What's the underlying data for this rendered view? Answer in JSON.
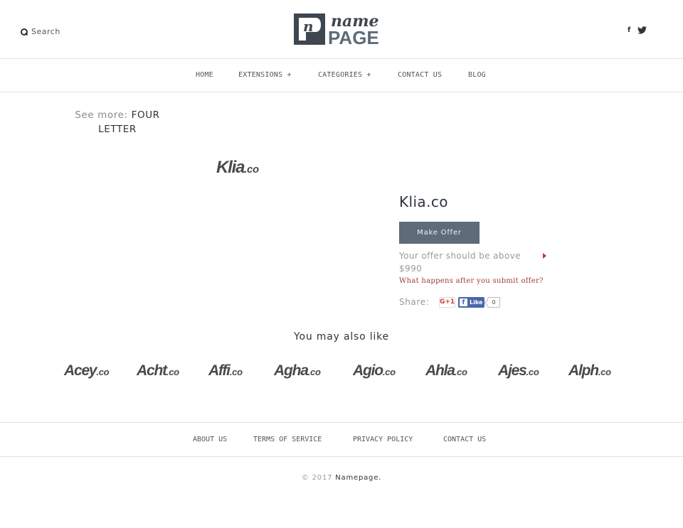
{
  "header": {
    "search_label": "Search",
    "logo": {
      "line1": "name",
      "line2": "PAGE",
      "mark": "n"
    },
    "social": {
      "facebook": "f"
    }
  },
  "nav": {
    "items": [
      {
        "label": "HOME"
      },
      {
        "label": "EXTENSIONS +"
      },
      {
        "label": "CATEGORIES +"
      },
      {
        "label": "CONTACT US"
      },
      {
        "label": "BLOG"
      }
    ]
  },
  "see_more": {
    "prefix": "See more:",
    "link": "FOUR LETTER"
  },
  "product": {
    "logo_name": "Klia",
    "logo_tld": ".co",
    "title": "Klia.co",
    "offer_button": "Make Offer",
    "offer_note": "Your offer should be above $990",
    "offer_help": "What happens after you submit offer?",
    "share_label": "Share:",
    "gplus_label": "G+1",
    "fb_like_label": "Like",
    "fb_like_count": "0",
    "accent_color": "#5e6b78"
  },
  "related": {
    "title": "You may also like",
    "items": [
      {
        "name": "Acey",
        "tld": ".co"
      },
      {
        "name": "Acht",
        "tld": ".co"
      },
      {
        "name": "Affi",
        "tld": ".co"
      },
      {
        "name": "Agha",
        "tld": ".co"
      },
      {
        "name": "Agio",
        "tld": ".co"
      },
      {
        "name": "Ahla",
        "tld": ".co"
      },
      {
        "name": "Ajes",
        "tld": ".co"
      },
      {
        "name": "Alph",
        "tld": ".co"
      }
    ]
  },
  "footer": {
    "links": [
      {
        "label": "ABOUT US"
      },
      {
        "label": "TERMS OF SERVICE"
      },
      {
        "label": "PRIVACY POLICY"
      },
      {
        "label": "CONTACT US"
      }
    ],
    "copyright_prefix": "© 2017",
    "copyright_name": "Namepage."
  }
}
